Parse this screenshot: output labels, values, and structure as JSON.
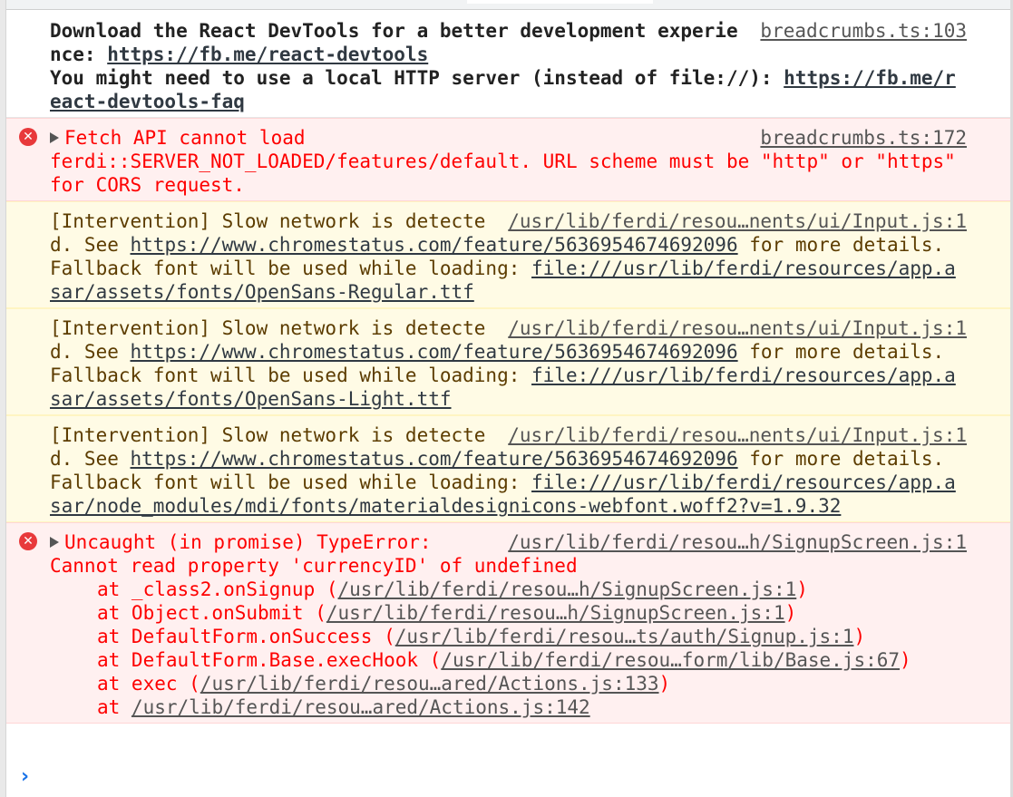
{
  "messages": {
    "info": {
      "source": "breadcrumbs.ts:103",
      "line1_text": "Download the React DevTools for a better development experience: ",
      "line1_link": "https://fb.me/react-devtools",
      "line2_text": "You might need to use a local HTTP server (instead of file://): ",
      "line2_link": "https://fb.me/react-devtools-faq"
    },
    "fetch_error": {
      "source": "breadcrumbs.ts:172",
      "text": "Fetch API cannot load ferdi::SERVER_NOT_LOADED/features/default. URL scheme must be \"http\" or \"https\" for CORS request."
    },
    "warnings": [
      {
        "source": "/usr/lib/ferdi/resou…nents/ui/Input.js:1",
        "text_a": "[Intervention] Slow network is detected. See ",
        "link_a": "https://www.chromestatus.com/feature/5636954674692096",
        "text_b": " for more details. Fallback font will be used while loading: ",
        "link_b": "file:///usr/lib/ferdi/resources/app.asar/assets/fonts/OpenSans-Regular.ttf"
      },
      {
        "source": "/usr/lib/ferdi/resou…nents/ui/Input.js:1",
        "text_a": "[Intervention] Slow network is detected. See ",
        "link_a": "https://www.chromestatus.com/feature/5636954674692096",
        "text_b": " for more details. Fallback font will be used while loading: ",
        "link_b": "file:///usr/lib/ferdi/resources/app.asar/assets/fonts/OpenSans-Light.ttf"
      },
      {
        "source": "/usr/lib/ferdi/resou…nents/ui/Input.js:1",
        "text_a": "[Intervention] Slow network is detected. See ",
        "link_a": "https://www.chromestatus.com/feature/5636954674692096",
        "text_b": " for more details. Fallback font will be used while loading: ",
        "link_b": "file:///usr/lib/ferdi/resources/app.asar/node_modules/mdi/fonts/materialdesignicons-webfont.woff2?v=1.9.32"
      }
    ],
    "type_error": {
      "source": "/usr/lib/ferdi/resou…h/SignupScreen.js:1",
      "title": "Uncaught (in promise) TypeError:",
      "detail": "Cannot read property 'currencyID' of undefined",
      "stack": [
        {
          "prefix": "at _class2.onSignup (",
          "link": "/usr/lib/ferdi/resou…h/SignupScreen.js:1",
          "suffix": ")"
        },
        {
          "prefix": "at Object.onSubmit (",
          "link": "/usr/lib/ferdi/resou…h/SignupScreen.js:1",
          "suffix": ")"
        },
        {
          "prefix": "at DefaultForm.onSuccess (",
          "link": "/usr/lib/ferdi/resou…ts/auth/Signup.js:1",
          "suffix": ")"
        },
        {
          "prefix": "at DefaultForm.Base.execHook (",
          "link": "/usr/lib/ferdi/resou…form/lib/Base.js:67",
          "suffix": ")"
        },
        {
          "prefix": "at exec (",
          "link": "/usr/lib/ferdi/resou…ared/Actions.js:133",
          "suffix": ")"
        },
        {
          "prefix": "at ",
          "link": "/usr/lib/ferdi/resou…ared/Actions.js:142",
          "suffix": ""
        }
      ]
    }
  },
  "prompt": {
    "symbol": "›"
  },
  "colors": {
    "error_bg": "#fff0f0",
    "error_text": "#fe0000",
    "warn_bg": "#fffbe5",
    "warn_text": "#5c3c00",
    "prompt": "#1a73e8"
  }
}
